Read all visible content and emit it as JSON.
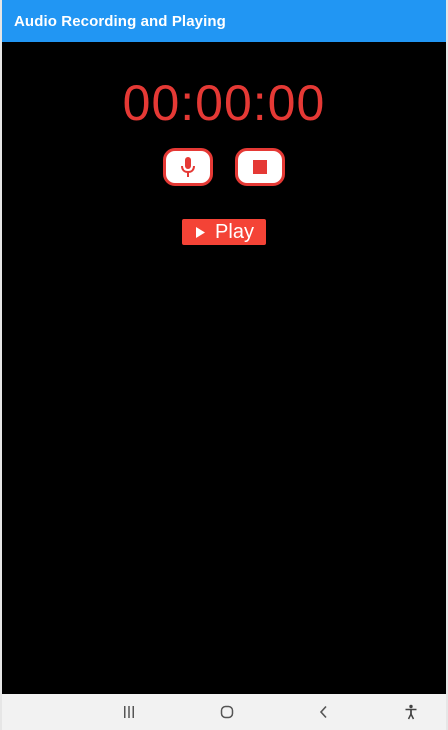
{
  "app_bar": {
    "title": "Audio Recording and Playing",
    "color": "#2196F3"
  },
  "recorder": {
    "timer": "00:00:00",
    "accent_color": "#E53935",
    "record_button_icon": "microphone-icon",
    "stop_button_icon": "stop-square-icon"
  },
  "player": {
    "play_label": "Play",
    "play_icon": "play-triangle-icon",
    "button_color": "#F44336"
  },
  "system_nav": {
    "recents_icon": "recents-icon",
    "home_icon": "home-icon",
    "back_icon": "back-icon",
    "accessibility_icon": "accessibility-icon"
  }
}
